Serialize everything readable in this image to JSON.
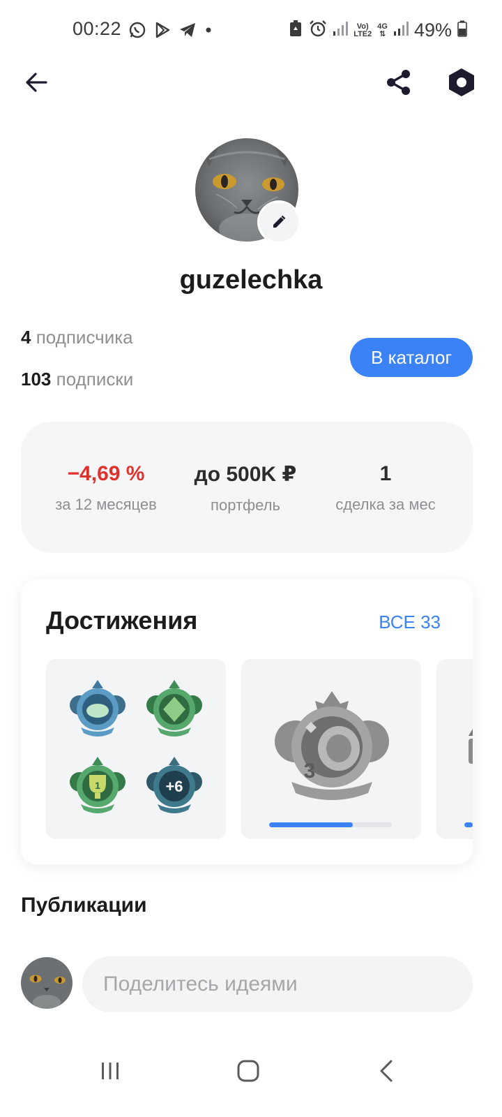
{
  "status_bar": {
    "time": "00:22",
    "battery": "49%",
    "network_label_top": "Vo)",
    "network_label_bottom": "LTE2",
    "network_4g": "4G"
  },
  "top_bar": {
    "back_icon": "arrow-left-icon",
    "share_icon": "share-icon",
    "settings_icon": "settings-hex-icon"
  },
  "profile": {
    "username": "guzelechka",
    "followers_count": "4",
    "followers_label": "подписчика",
    "following_count": "103",
    "following_label": "подписки",
    "catalog_button": "В каталог"
  },
  "stats": [
    {
      "value": "−4,69 %",
      "label": "за 12 месяцев",
      "color": "#e0322d"
    },
    {
      "value": "до 500K ₽",
      "label": "портфель"
    },
    {
      "value": "1",
      "label": "сделка за мес"
    }
  ],
  "achievements": {
    "title": "Достижения",
    "all_link": "ВСЕ 33",
    "extra_badges": "+6",
    "trophy_label": "1",
    "featured_level": "3",
    "featured_progress": 0.68
  },
  "publications": {
    "title": "Публикации",
    "input_placeholder": "Поделитесь идеями"
  },
  "colors": {
    "accent": "#3b82f6",
    "negative": "#e0322d"
  }
}
